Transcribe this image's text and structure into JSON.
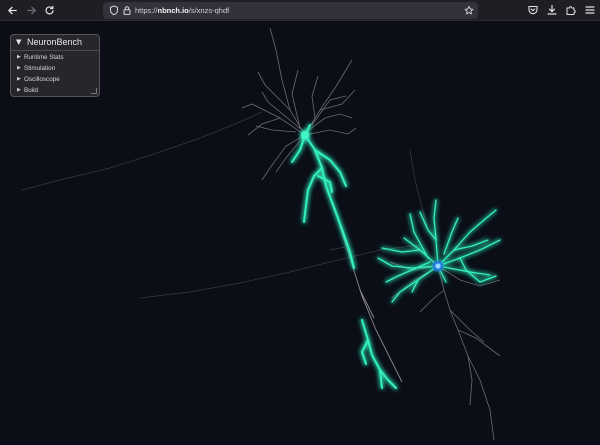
{
  "browser": {
    "url_prefix": "https://",
    "url_host": "nbnch.io",
    "url_path": "/s/xnzs-qhdf",
    "back_icon": "arrow-left-icon",
    "forward_icon": "arrow-right-icon",
    "reload_icon": "reload-icon"
  },
  "panel": {
    "title": "NeuronBench",
    "items": [
      {
        "label": "Runtime Stats"
      },
      {
        "label": "Stimulation"
      },
      {
        "label": "Oscilloscope"
      },
      {
        "label": "Build"
      }
    ]
  },
  "colors": {
    "background": "#0b0e17",
    "dendrite_idle": "#8a8488",
    "dendrite_active": "#33f0c0",
    "soma": "#3aa0ff"
  }
}
